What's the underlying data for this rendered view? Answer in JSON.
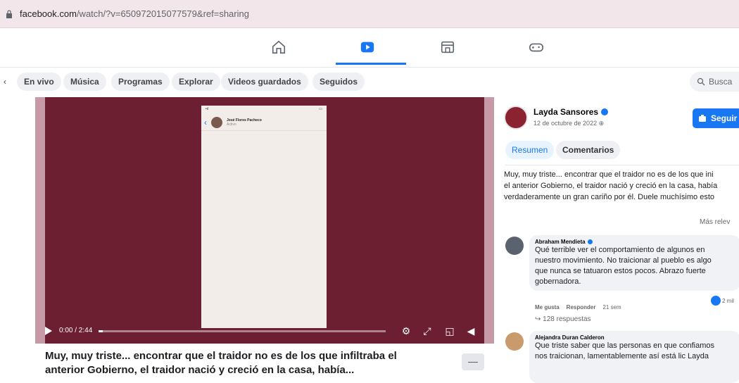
{
  "browser": {
    "url_domain": "facebook.com",
    "url_path": "/watch/?v=650972015077579&ref=sharing"
  },
  "topnav": {
    "icons": [
      "home-icon",
      "watch-icon",
      "marketplace-icon",
      "gaming-icon"
    ],
    "active": "watch-icon",
    "accent": "#1877f2"
  },
  "chips": {
    "items": [
      "En vivo",
      "Música",
      "Programas",
      "Explorar",
      "Videos guardados",
      "Seguidos"
    ],
    "search_placeholder": "Busca"
  },
  "video": {
    "time": "0:00 / 2:44",
    "progress": 0.0,
    "phone_chat_name": "José Flores Pacheco",
    "phone_chat_sub": "Activo",
    "background_color": "#6b1f31"
  },
  "caption": {
    "text_line1": "Muy, muy triste... encontrar que el traidor no es de los que infiltraba el",
    "text_line2": "anterior Gobierno, el traidor nació y creció en la casa, había...",
    "more_label": "—"
  },
  "panel": {
    "author": "Layda Sansores",
    "date": "12 de octubre de 2022",
    "follow_label": "Seguir",
    "tabs": [
      "Resumen",
      "Comentarios"
    ],
    "description_lines": [
      "Muy, muy triste... encontrar que el traidor no es de los que ini",
      "el anterior Gobierno, el traidor nació y creció en la casa, había",
      "verdaderamente un gran cariño por él. Duele muchísimo esto"
    ],
    "sort_label": "Más relev",
    "comments": [
      {
        "author": "Abraham Mendieta",
        "lines": [
          "Qué terrible ver el comportamiento de algunos en",
          "nuestro movimiento. No traicionar al pueblo es algo",
          "que nunca se tatuaron estos pocos. Abrazo fuerte",
          "gobernadora."
        ],
        "like_label": "Me gusta",
        "reply_label": "Responder",
        "time_ago": "21 sem",
        "reactions": "2 mil",
        "replies": "128 respuestas"
      },
      {
        "author": "Alejandra Duran Calderon",
        "lines": [
          "Que triste saber que las personas en que confiamos",
          "nos traicionan, lamentablemente así está lic Layda"
        ]
      }
    ]
  }
}
